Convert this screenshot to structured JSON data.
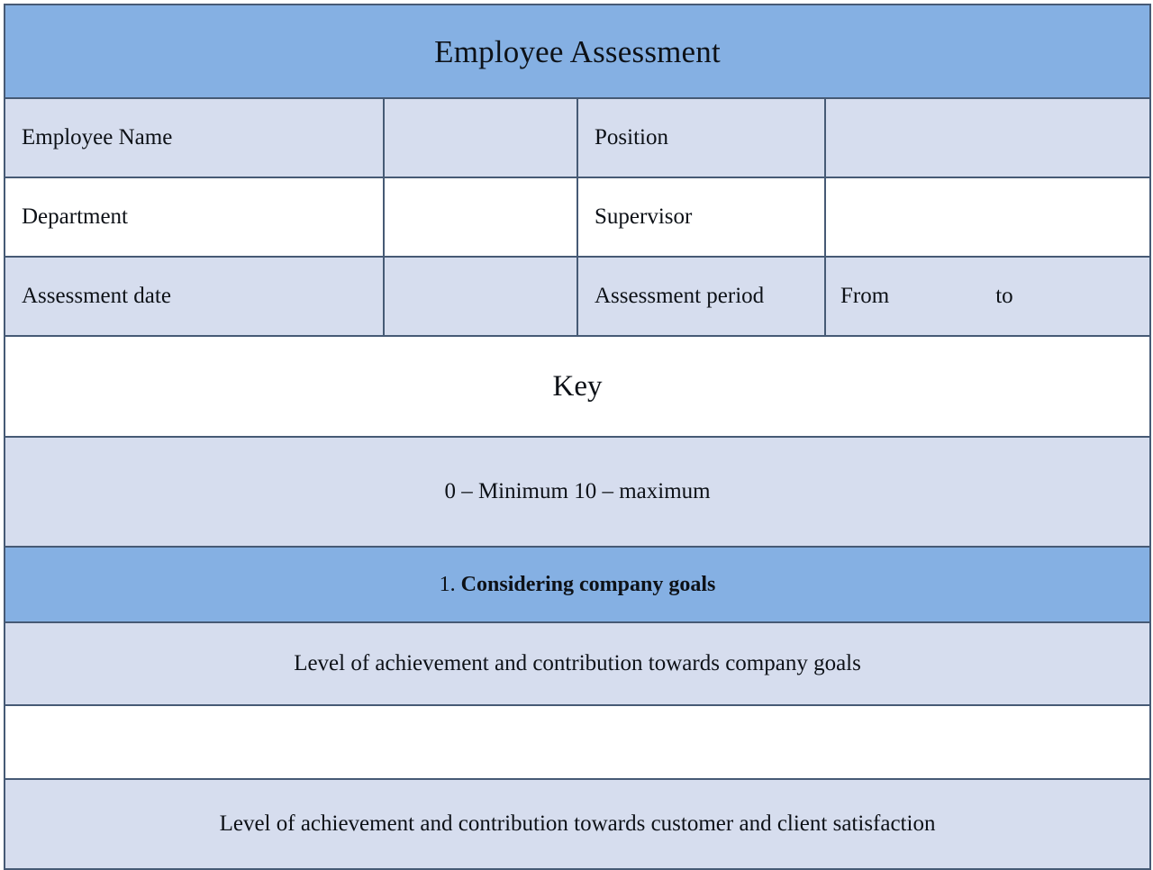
{
  "document": {
    "title": "Employee Assessment"
  },
  "info_rows": [
    {
      "label_left": "Employee Name",
      "value_left": "",
      "label_right": "Position",
      "value_right": ""
    },
    {
      "label_left": "Department",
      "value_left": "",
      "label_right": "Supervisor",
      "value_right": ""
    },
    {
      "label_left": "Assessment date",
      "value_left": "",
      "label_right": "Assessment period",
      "value_right": ""
    }
  ],
  "period": {
    "from_label": "From",
    "to_label": "to"
  },
  "key": {
    "heading": "Key",
    "scale": "0 – Minimum 10 – maximum"
  },
  "sections": [
    {
      "number": "1.",
      "title": "Considering company goals",
      "criteria": [
        "Level of achievement and contribution towards company goals",
        "Level of achievement and contribution towards customer and client satisfaction"
      ],
      "answers": [
        ""
      ]
    }
  ],
  "colors": {
    "header_blue": "#85b0e3",
    "cell_light": "#d6ddee",
    "cell_white": "#ffffff",
    "border": "#465a75",
    "text": "#0d1117"
  }
}
